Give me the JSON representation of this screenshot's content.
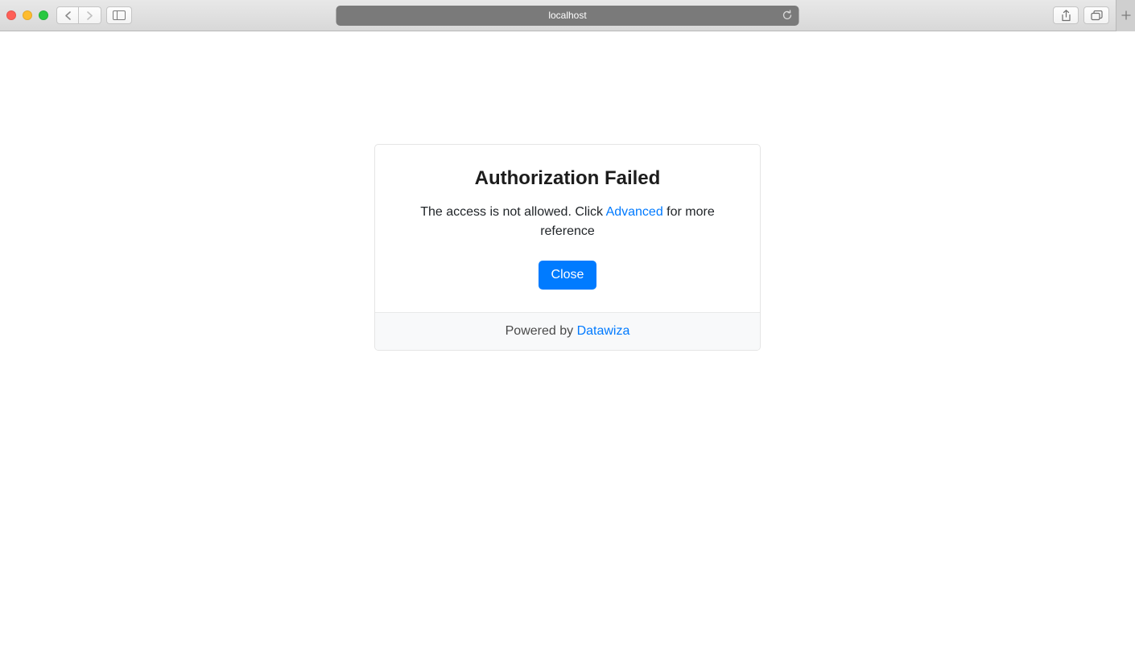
{
  "browser": {
    "url": "localhost"
  },
  "dialog": {
    "title": "Authorization Failed",
    "message_before": "The access is not allowed. Click ",
    "advanced_link": "Advanced",
    "message_after": " for more reference",
    "close_label": "Close"
  },
  "footer": {
    "powered_by": "Powered by ",
    "brand": "Datawiza"
  }
}
